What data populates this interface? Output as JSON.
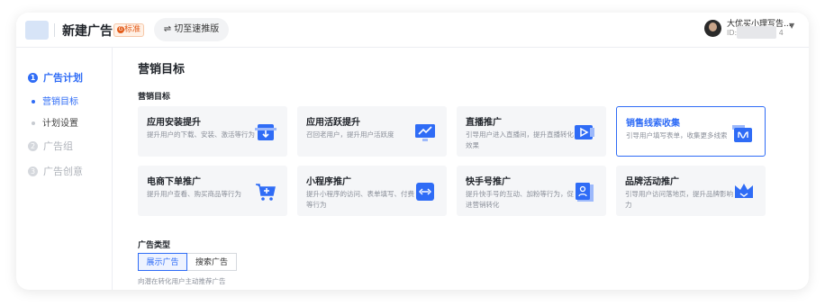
{
  "header": {
    "title": "新建广告",
    "badge": "标准",
    "switch_label": "⇌ 切至速推版",
    "user_name": "大优买小理写告...",
    "user_id_prefix": "ID: ",
    "user_id_suffix": "4"
  },
  "sidebar": {
    "steps": [
      {
        "num": "1",
        "label": "广告计划"
      },
      {
        "num": "2",
        "label": "广告组"
      },
      {
        "num": "3",
        "label": "广告创意"
      }
    ],
    "subitems": [
      {
        "label": "营销目标"
      },
      {
        "label": "计划设置"
      }
    ]
  },
  "main": {
    "heading": "营销目标",
    "section_label": "营销目标",
    "cards": [
      {
        "title": "应用安装提升",
        "desc": "提升用户的下载、安装、激活等行为",
        "icon": "download-app-icon"
      },
      {
        "title": "应用活跃提升",
        "desc": "召回老用户，提升用户活跃度",
        "icon": "trend-up-icon"
      },
      {
        "title": "直播推广",
        "desc": "引导用户进入直播间，提升直播转化效果",
        "icon": "live-play-icon"
      },
      {
        "title": "销售线索收集",
        "desc": "引导用户填写表单，收集更多线索",
        "icon": "lead-collect-icon",
        "selected": true
      },
      {
        "title": "电商下单推广",
        "desc": "提升用户查看、购买商品等行为",
        "icon": "shopping-cart-icon"
      },
      {
        "title": "小程序推广",
        "desc": "提升小程序的访问、表单填写、付费等行为",
        "icon": "mini-program-icon"
      },
      {
        "title": "快手号推广",
        "desc": "提升快手号的互动、加粉等行为，促进营销转化",
        "icon": "kuaishou-account-icon"
      },
      {
        "title": "品牌活动推广",
        "desc": "引导用户访问落地页，提升品牌影响力",
        "icon": "brand-crown-icon"
      }
    ],
    "ad_type_label": "广告类型",
    "ad_types": [
      "展示广告",
      "搜索广告"
    ],
    "ad_type_hint": "向潜在转化用户主动推荐广告"
  },
  "colors": {
    "accent": "#2f6cf6",
    "card_bg": "#f5f6f8"
  }
}
